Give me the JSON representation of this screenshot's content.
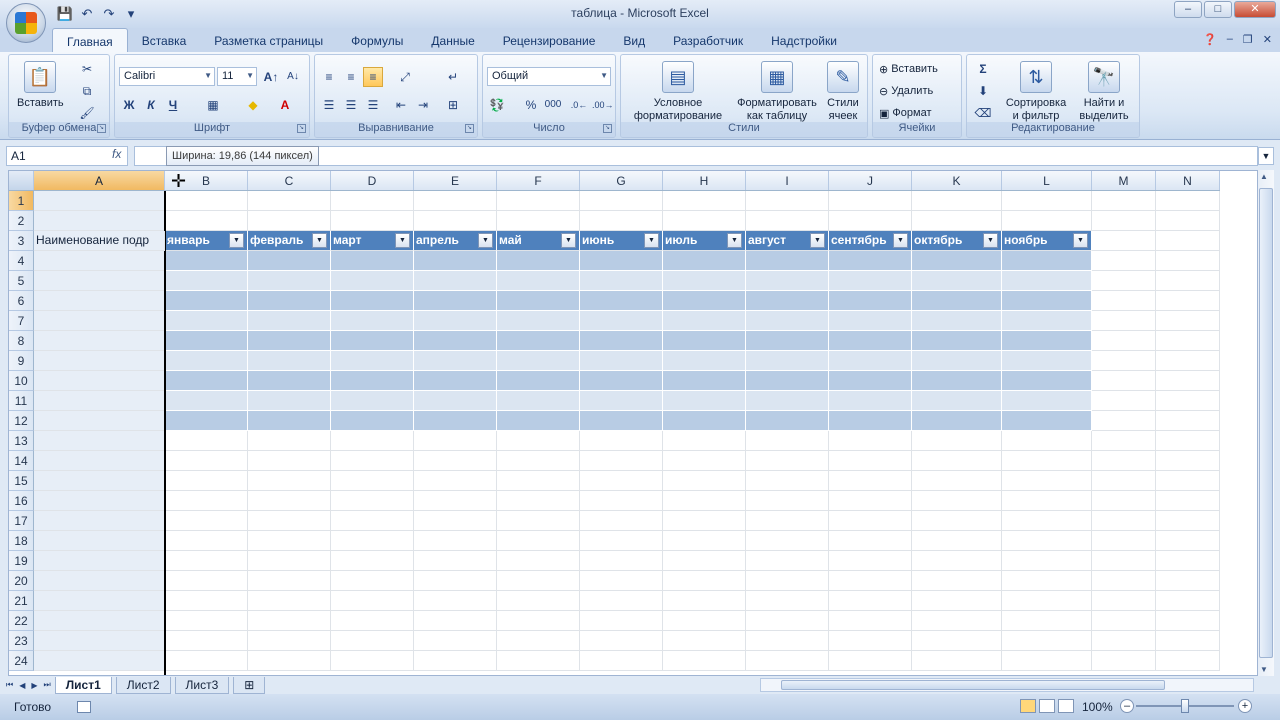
{
  "window": {
    "title": "таблица - Microsoft Excel"
  },
  "tabs": [
    "Главная",
    "Вставка",
    "Разметка страницы",
    "Формулы",
    "Данные",
    "Рецензирование",
    "Вид",
    "Разработчик",
    "Надстройки"
  ],
  "ribbon": {
    "clipboard": {
      "label": "Буфер обмена",
      "paste": "Вставить"
    },
    "font": {
      "label": "Шрифт",
      "name": "Calibri",
      "size": "11",
      "bold": "Ж",
      "italic": "К",
      "underline": "Ч"
    },
    "align": {
      "label": "Выравнивание"
    },
    "number": {
      "label": "Число",
      "format": "Общий",
      "percent": "%",
      "thousands": "000"
    },
    "styles": {
      "label": "Стили",
      "conditional_1": "Условное",
      "conditional_2": "форматирование",
      "astable_1": "Форматировать",
      "astable_2": "как таблицу",
      "cellstyles_1": "Стили",
      "cellstyles_2": "ячеек"
    },
    "cells": {
      "label": "Ячейки",
      "insert": "Вставить",
      "delete": "Удалить",
      "format": "Формат"
    },
    "edit": {
      "label": "Редактирование",
      "sort_1": "Сортировка",
      "sort_2": "и фильтр",
      "find_1": "Найти и",
      "find_2": "выделить"
    }
  },
  "formula": {
    "namebox": "A1",
    "fx": "fx",
    "tooltip": "Ширина: 19,86 (144 пиксел)"
  },
  "columns": [
    "A",
    "B",
    "C",
    "D",
    "E",
    "F",
    "G",
    "H",
    "I",
    "J",
    "K",
    "L",
    "M",
    "N"
  ],
  "rows": [
    "1",
    "2",
    "3",
    "4",
    "5",
    "6",
    "7",
    "8",
    "9",
    "10",
    "11",
    "12",
    "13",
    "14",
    "15",
    "16",
    "17",
    "18",
    "19",
    "20",
    "21",
    "22",
    "23",
    "24"
  ],
  "table": {
    "a3": "Наименование подр",
    "headers": [
      "январь",
      "февраль",
      "март",
      "апрель",
      "май",
      "июнь",
      "июль",
      "август",
      "сентябрь",
      "октябрь",
      "ноябрь"
    ]
  },
  "sheets": [
    "Лист1",
    "Лист2",
    "Лист3"
  ],
  "status": {
    "ready": "Готово",
    "zoom": "100%"
  }
}
